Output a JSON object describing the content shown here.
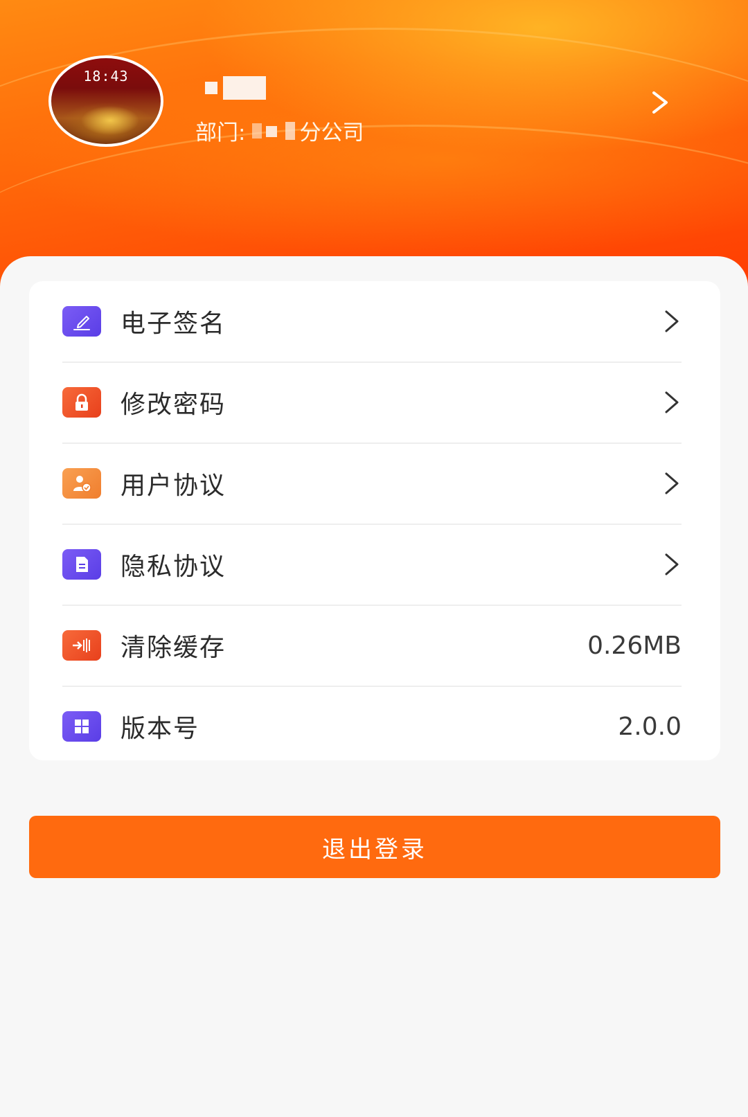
{
  "profile": {
    "avatar_time": "18:43",
    "department_prefix": "部门:",
    "department_suffix": "分公司"
  },
  "menu": {
    "items": [
      {
        "label": "电子签名",
        "icon": "signature-icon",
        "color": "#6a4bf0"
      },
      {
        "label": "修改密码",
        "icon": "lock-icon",
        "color": "#f0502a"
      },
      {
        "label": "用户协议",
        "icon": "user-agreement-icon",
        "color": "#f48a3c"
      },
      {
        "label": "隐私协议",
        "icon": "document-icon",
        "color": "#6a4bf0"
      },
      {
        "label": "清除缓存",
        "icon": "clear-cache-icon",
        "color": "#f0502a",
        "value": "0.26MB"
      },
      {
        "label": "版本号",
        "icon": "grid-icon",
        "color": "#6a4bf0",
        "value": "2.0.0"
      }
    ]
  },
  "logout": {
    "label": "退出登录",
    "color": "#ff6a0f"
  }
}
